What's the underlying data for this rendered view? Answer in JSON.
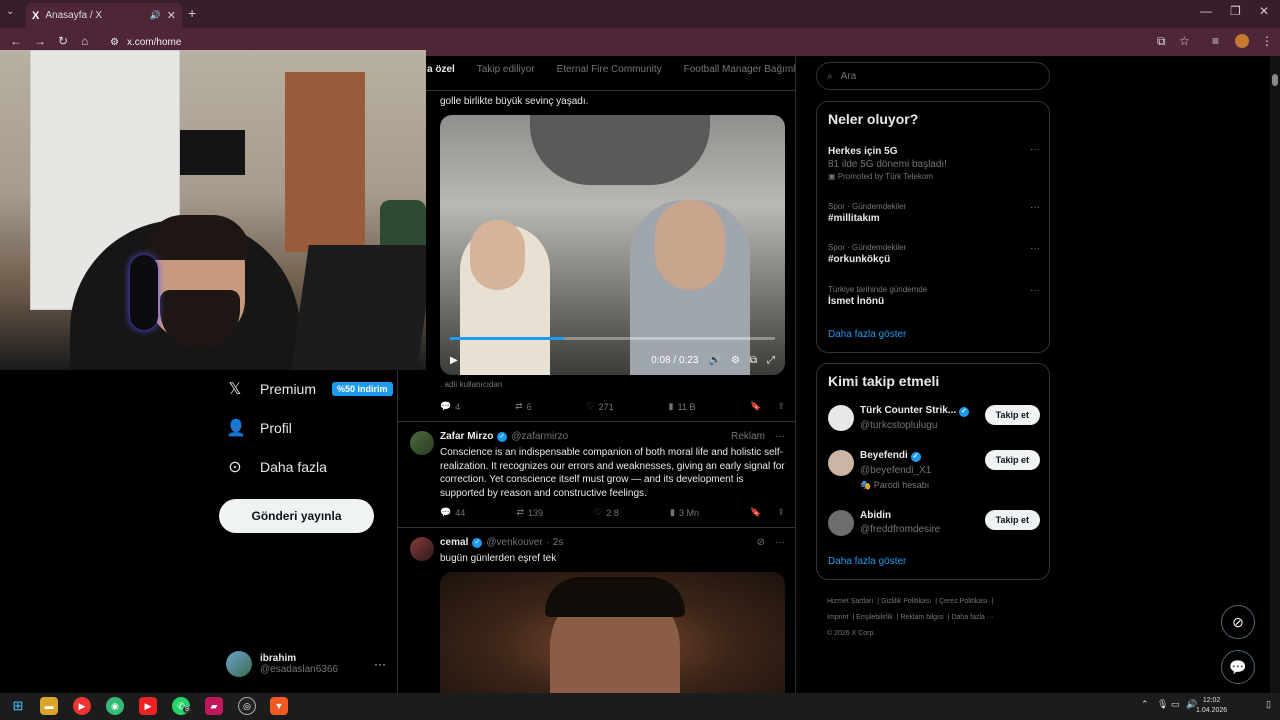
{
  "browser": {
    "tab_title": "Anasayfa / X",
    "tab_logo": "X",
    "url": "x.com/home",
    "icons": [
      "chevron-down-icon",
      "volume-icon",
      "close-icon",
      "plus-icon",
      "back-icon",
      "forward-icon",
      "reload-icon",
      "home-icon",
      "site-info-icon",
      "install-icon",
      "star-icon",
      "media-icon",
      "profile-icon",
      "kebab-icon",
      "minimize-icon",
      "restore-icon",
      "close-window-icon"
    ]
  },
  "nav": {
    "premium_label": "Premium",
    "premium_badge": "%50 indirim",
    "profile_label": "Profil",
    "more_label": "Daha fazla",
    "post_button": "Gönderi yayınla",
    "account_name": "ibrahim",
    "account_handle": "@esadaslan6366"
  },
  "feed_tabs": [
    "a özel",
    "Takip ediliyor",
    "Eternal Fire Community",
    "Football Manager Bağımlı"
  ],
  "tweet1": {
    "text": "golle birlikte büyük sevinç yaşadı.",
    "video_time": "0:08 / 0:23",
    "video_progress": 0.35,
    "attribution": "adlı kullanıcıdan",
    "replies": "4",
    "reposts": "6",
    "likes": "271",
    "views": "11 B"
  },
  "tweet2": {
    "name": "Zafar Mirzo",
    "handle": "@zafarmirzo",
    "ad_label": "Reklam",
    "text": "Conscience is an indispensable companion of both moral life and holistic self-realization. It recognizes our errors and weaknesses, giving an early signal for correction. Yet conscience itself must grow — and its development is supported by reason and constructive feelings.",
    "replies": "44",
    "reposts": "139",
    "likes": "2 8",
    "views": "3 Mn"
  },
  "tweet3": {
    "name": "cemal",
    "handle": "@venkouver",
    "time": "· 2s",
    "text": "bugün günlerden eşref tek"
  },
  "search": {
    "placeholder": "Ara"
  },
  "trends": {
    "title": "Neler oluyor?",
    "items": [
      {
        "name": "Herkes için 5G",
        "sub": "81 ilde 5G dönemi başladı!",
        "promo": "Promoted by Türk Telekom"
      },
      {
        "ctx": "Spor · Gündemdekiler",
        "name": "#millitakım"
      },
      {
        "ctx": "Spor · Gündemdekiler",
        "name": "#orkunkökçü"
      },
      {
        "ctx": "Türkiye tarihinde gündemde",
        "name": "İsmet İnönü"
      }
    ],
    "show_more": "Daha fazla göster"
  },
  "who_to_follow": {
    "title": "Kimi takip etmeli",
    "follow_label": "Takip et",
    "accounts": [
      {
        "name": "Türk Counter Strik...",
        "handle": "@turkcstoplulugu",
        "extra": ""
      },
      {
        "name": "Beyefendi",
        "handle": "@beyefendi_X1",
        "extra": "Parodi hesabı"
      },
      {
        "name": "Abidin",
        "handle": "@freddfromdesire",
        "extra": ""
      }
    ],
    "show_more": "Daha fazla göster"
  },
  "footer": {
    "links": [
      "Hizmet Şartları",
      "Gizlilik Politikası",
      "Çerez Politikası",
      "Imprint",
      "Erişilebilirlik",
      "Reklam bilgisi",
      "Daha fazla ···"
    ],
    "copyright": "© 2026 X Corp."
  },
  "taskbar": {
    "time": "12:02",
    "date": "1.04.2026",
    "whatsapp_badge": "9"
  },
  "colors": {
    "accent": "#1d9bf0",
    "chrome": "#3a1d2b",
    "toolbar": "#4e2638"
  }
}
